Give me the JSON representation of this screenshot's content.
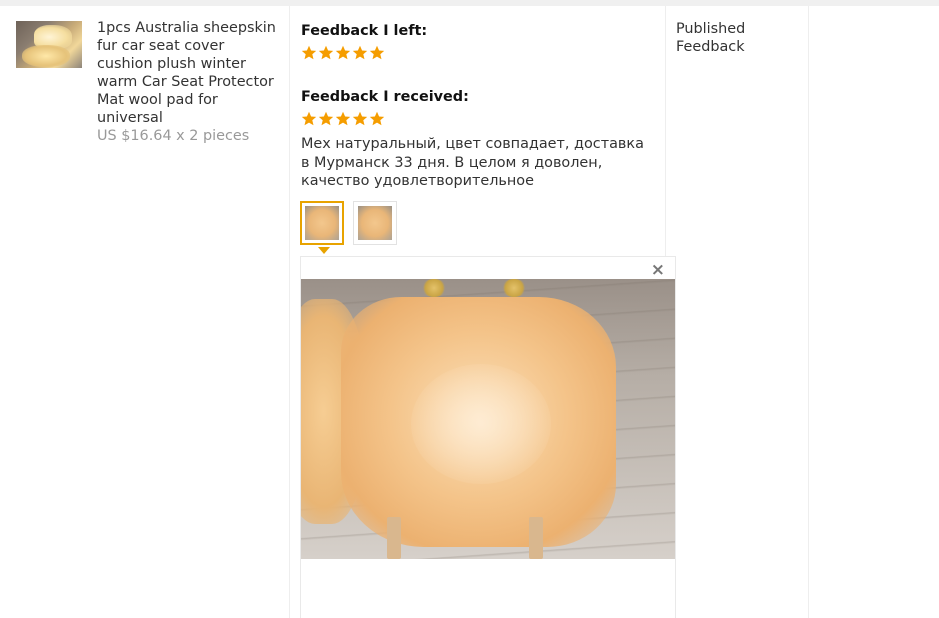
{
  "product": {
    "thumbnail_icon": "sheepskin-seat-cover-thumbnail",
    "title": "1pcs Australia sheepskin fur car seat cover cushion plush winter warm Car Seat Protector Mat wool pad for universal",
    "price": "US $16.64 x 2 pieces"
  },
  "feedback_left": {
    "heading": "Feedback I left:",
    "rating": 5,
    "max_rating": 5
  },
  "feedback_received": {
    "heading": "Feedback I received:",
    "rating": 5,
    "max_rating": 5,
    "text": "Мех натуральный, цвет совпадает, доставка в Мурманск 33 дня. В целом я доволен, качество удовлетворительное",
    "photo_count": 2,
    "selected_photo": 1
  },
  "viewer": {
    "close_glyph": "×",
    "photo_icon": "sheepskin-photo"
  },
  "status": "Published Feedback",
  "colors": {
    "star": "#f59d00",
    "accent": "#e8a300",
    "muted_text": "#999999"
  }
}
